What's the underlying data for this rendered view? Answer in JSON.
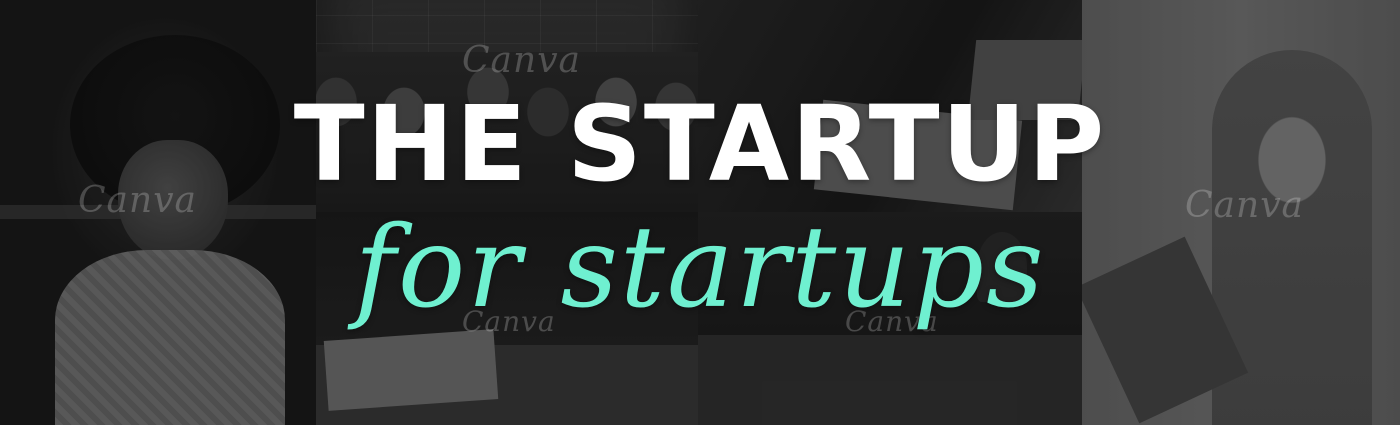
{
  "banner": {
    "title": "THE STARTUP",
    "subtitle": "for startups",
    "accent_color": "#6ff0d0",
    "title_color": "#ffffff"
  },
  "watermarks": [
    "Canva",
    "Canva",
    "Canva",
    "Canva",
    "Canva"
  ],
  "photos": [
    "woman-with-curly-hair",
    "group-of-people-against-brick-wall",
    "hand-writing-at-desk-with-laptop",
    "desk-with-documents-and-glass",
    "team-meeting-at-table",
    "woman-holding-folder"
  ]
}
